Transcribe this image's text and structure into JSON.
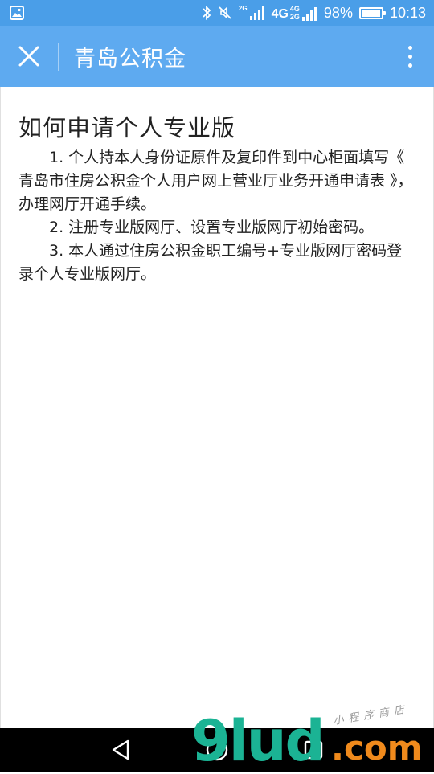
{
  "status_bar": {
    "network": "4G",
    "network_secondary_top": "4G",
    "network_secondary_bottom": "2G",
    "network_small": "2G",
    "battery_text": "98%",
    "battery_level": 0.98,
    "time": "10:13"
  },
  "app_bar": {
    "title": "青岛公积金",
    "close_icon": "close-icon",
    "more_icon": "more-vertical-icon"
  },
  "article": {
    "title": "如何申请个人专业版",
    "paragraphs": [
      "1. 个人持本人身份证原件及复印件到中心柜面填写《 青岛市住房公积金个人用户网上营业厅业务开通申请表 》，办理网厅开通手续。",
      "2. 注册专业版网厅、设置专业版网厅初始密码。",
      "3. 本人通过住房公积金职工编号+专业版网厅密码登录个人专业版网厅。"
    ]
  },
  "nav_bar": {
    "back_icon": "back-triangle-icon",
    "home_icon": "home-circle-icon",
    "recents_icon": "recents-square-icon"
  },
  "watermark": {
    "brand": "9lud",
    "suffix": ".com",
    "small": "小程序商店"
  },
  "colors": {
    "status_bar": "#4a9ee8",
    "app_bar": "#5eaaf0",
    "text": "#222222",
    "watermark_green": "#1bb394",
    "watermark_orange": "#f08a1c"
  }
}
